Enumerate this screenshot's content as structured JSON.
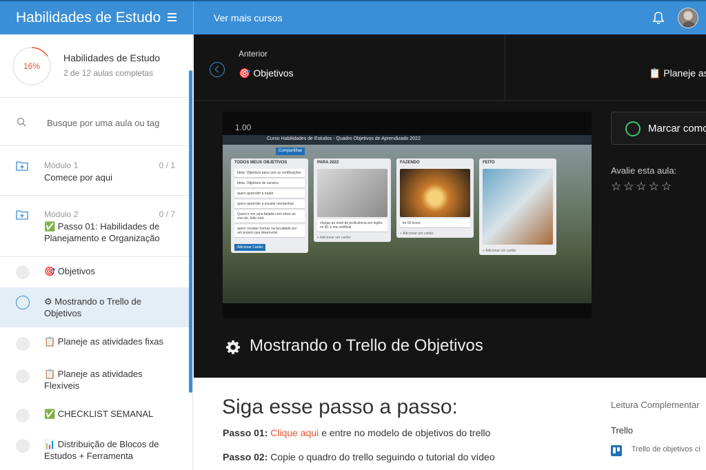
{
  "header": {
    "brand": "Habilidades de Estudo",
    "more_courses": "Ver mais cursos"
  },
  "sidebar": {
    "progress_percent": "16%",
    "progress_fraction": 0.16,
    "course_title": "Habilidades de Estudo",
    "course_subtitle": "2 de 12 aulas completas",
    "search_placeholder": "Busque por uma aula ou tag",
    "modules": [
      {
        "label": "Módulo 1",
        "count": "0 / 1",
        "title": "Comece por aqui"
      },
      {
        "label": "Módulo 2",
        "count": "0 / 7",
        "title": "✅ Passo 01: Habilidades de Planejamento e Organização"
      }
    ],
    "lessons": [
      {
        "emoji": "🎯",
        "title": "Objetivos"
      },
      {
        "emoji": "⚙",
        "title": "Mostrando o Trello de Objetivos"
      },
      {
        "emoji": "📋",
        "title": "Planeje as atividades fixas"
      },
      {
        "emoji": "📋",
        "title": "Planeje as atividades Flexíveis"
      },
      {
        "emoji": "✅",
        "title": "CHECKLIST SEMANAL"
      },
      {
        "emoji": "📊",
        "title": "Distribuição de Blocos de Estudos + Ferramenta"
      }
    ]
  },
  "player": {
    "prev_label": "Anterior",
    "prev_lesson": "🎯 Objetivos",
    "next_lesson": "📋 Planeje as a",
    "video_time": "1.00",
    "lesson_heading": "Mostrando o Trello de Objetivos",
    "complete_button": "Marcar como",
    "rate_label": "Avalie esta aula:",
    "stars": [
      "☆",
      "☆",
      "☆",
      "☆",
      "☆"
    ]
  },
  "trello": {
    "board_title": "Curso Habilidades de Estudos - Quadro Objetivos de Aprendizado 2022",
    "share": "Compartilhar",
    "lists": [
      {
        "title": "TODOS MEUS OBJETIVOS",
        "cards": [
          "Ideia: Objetivos para com as certificações",
          "Ideia: Objetivos de carreira",
          "quero aprender a nadar",
          "quero aprender a escalar montanhas",
          "Quero ir em uma balada com show ao vivo do João rock",
          "quero receber honras na faculdade por um projeto que desenvolvi"
        ],
        "add": "Adicionar Cartão"
      },
      {
        "title": "PARA 2022",
        "cards": [
          "chegar ao nível de proficiência em inglês no B1 e ma certificar"
        ],
        "add": "+ Adicionar um cartão"
      },
      {
        "title": "FAZENDO",
        "cards": [
          "ler 60 livros"
        ],
        "add": "+ Adicionar um cartão"
      },
      {
        "title": "FEITO",
        "cards": [],
        "add": "+ Adicionar um cartão"
      }
    ]
  },
  "content": {
    "title": "Siga esse passo a passo:",
    "steps": [
      {
        "label": "Passo 01:",
        "link": "Clique aqui",
        "text": "e entre no modelo de objetivos do trello"
      },
      {
        "label": "Passo 02:",
        "text": "Copie o quadro do trello seguindo o tutorial do vídeo"
      }
    ],
    "side_title": "Leitura Complementar",
    "side_heading": "Trello",
    "side_link": "Trello de objetivos ci"
  },
  "colors": {
    "accent": "#3a8fd6",
    "progress": "#e8542d",
    "complete": "#3ec46d",
    "dark_bg": "#141414"
  }
}
